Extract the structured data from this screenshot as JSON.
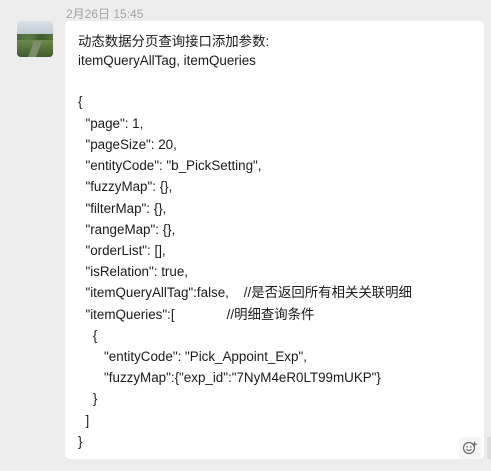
{
  "message": {
    "timestamp": "2月26日 15:45",
    "lines": [
      "动态数据分页查询接口添加参数:",
      "itemQueryAllTag, itemQueries",
      "",
      "{",
      "  \"page\": 1,",
      "  \"pageSize\": 20,",
      "  \"entityCode\": \"b_PickSetting\",",
      "  \"fuzzyMap\": {},",
      "  \"filterMap\": {},",
      "  \"rangeMap\": {},",
      "  \"orderList\": [],",
      "  \"isRelation\": true,",
      "  \"itemQueryAllTag\":false,    //是否返回所有相关关联明细",
      "  \"itemQueries\":[              //明细查询条件",
      "    {",
      "       \"entityCode\": \"Pick_Appoint_Exp\",",
      "       \"fuzzyMap\":{\"exp_id\":\"7NyM4eR0LT99mUKP\"}",
      "    }",
      "  ]",
      "}"
    ]
  },
  "icons": {
    "avatar": "landscape-avatar",
    "reaction": "emoji-add-icon"
  }
}
